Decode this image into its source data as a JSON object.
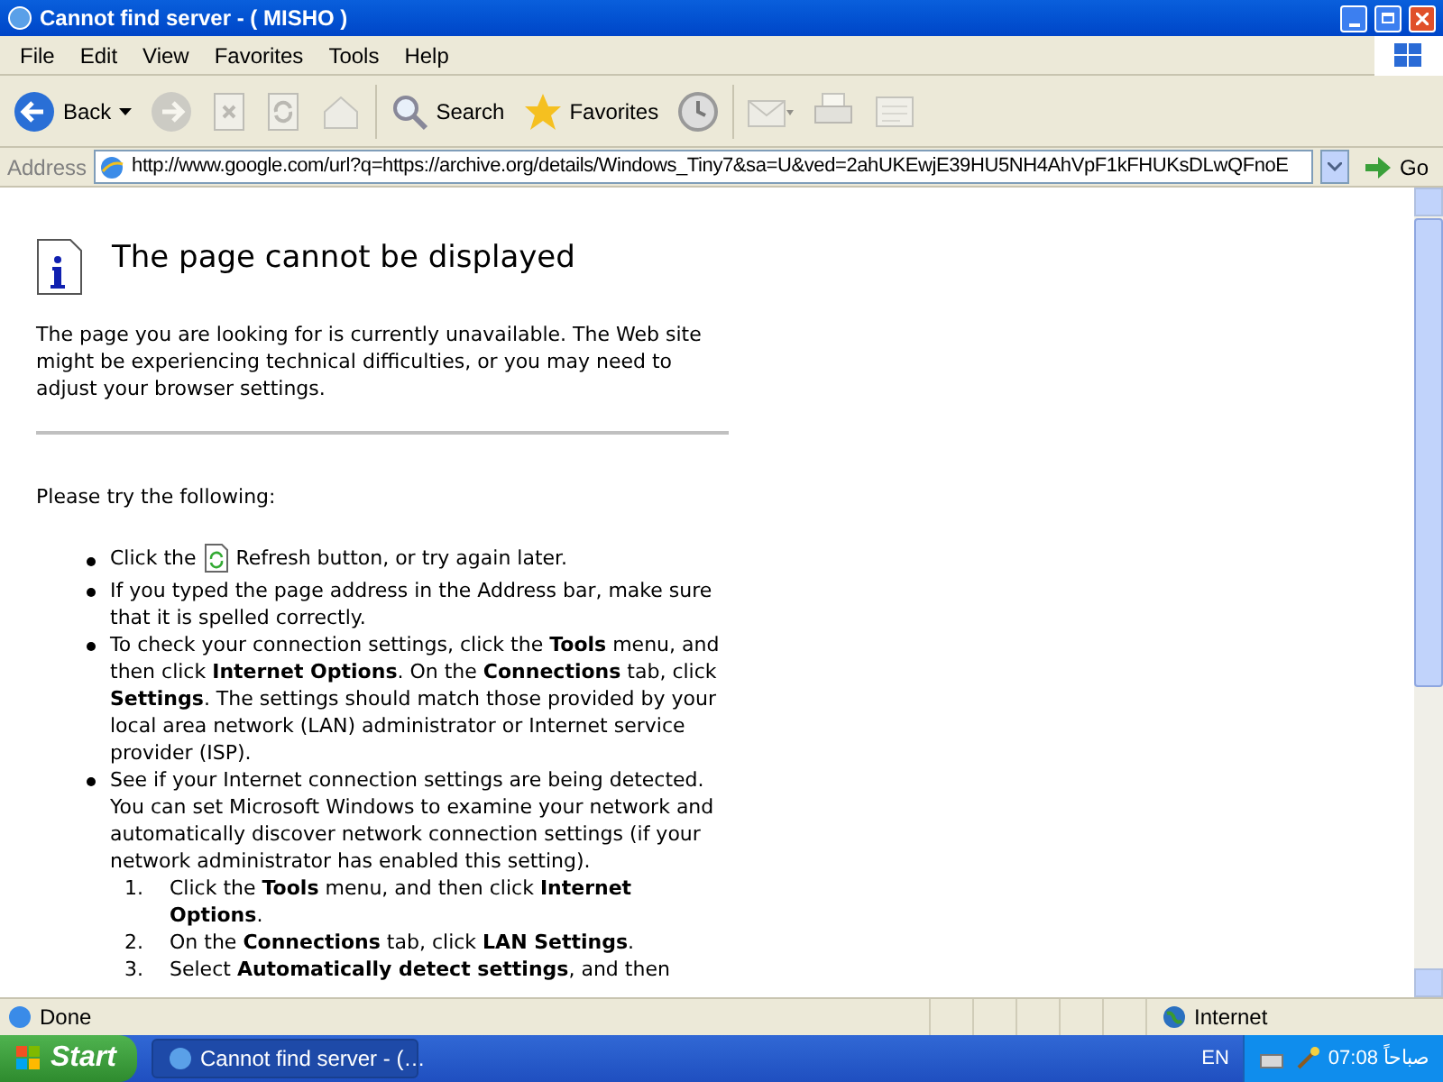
{
  "window": {
    "title": "Cannot find server - ( MISHO )"
  },
  "menu": [
    "File",
    "Edit",
    "View",
    "Favorites",
    "Tools",
    "Help"
  ],
  "toolbar": [
    {
      "kind": "back",
      "label": "Back",
      "disabled": false
    },
    {
      "kind": "forward",
      "disabled": true
    },
    {
      "kind": "stop",
      "disabled": true
    },
    {
      "kind": "refresh",
      "disabled": true
    },
    {
      "kind": "home",
      "disabled": true
    },
    {
      "kind": "search",
      "label": "Search",
      "disabled": false
    },
    {
      "kind": "favorites",
      "label": "Favorites",
      "disabled": false
    },
    {
      "kind": "history",
      "disabled": false
    },
    {
      "kind": "mail",
      "disabled": true
    },
    {
      "kind": "print",
      "disabled": true
    },
    {
      "kind": "edit",
      "disabled": true
    }
  ],
  "address": {
    "label": "Address",
    "value": "http://www.google.com/url?q=https://archive.org/details/Windows_Tiny7&sa=U&ved=2ahUKEwjE39HU5NH4AhVpF1kFHUKsDLwQFnoE",
    "go": "Go"
  },
  "page": {
    "heading": "The page cannot be displayed",
    "intro": "The page you are looking for is currently unavailable. The Web site might be experiencing technical difficulties, or you may need to adjust your browser settings.",
    "try": "Please try the following:",
    "items": [
      {
        "kind": "refresh_hint",
        "before": "Click the",
        "after": "Refresh button, or try again later."
      },
      {
        "kind": "text",
        "text": "If you typed the page address in the Address bar, make sure that it is spelled correctly."
      },
      {
        "kind": "text",
        "text": "To check your connection settings, click the **Tools** menu, and then click **Internet Options**. On the **Connections** tab, click **Settings**. The settings should match those provided by your local area network (LAN) administrator or Internet service provider (ISP)."
      },
      {
        "kind": "text",
        "text": "See if your Internet connection settings are being detected. You can set Microsoft Windows to examine your network and automatically discover network connection settings (if your network administrator has enabled this setting).",
        "children": [
          {
            "number": "1.",
            "text": "Click the **Tools** menu, and then click **Internet Options**."
          },
          {
            "number": "2.",
            "text": "On the **Connections** tab, click **LAN Settings**."
          },
          {
            "number": "3.",
            "text": "Select **Automatically detect settings**, and then"
          }
        ]
      }
    ]
  },
  "status_bar": {
    "text": "Done",
    "zone": "Internet"
  },
  "taskbar": {
    "start": "Start",
    "tasks": [
      {
        "label": "Cannot find server - (…",
        "selected": true
      }
    ],
    "language": "EN",
    "clock": "07:08 صباحاً"
  }
}
